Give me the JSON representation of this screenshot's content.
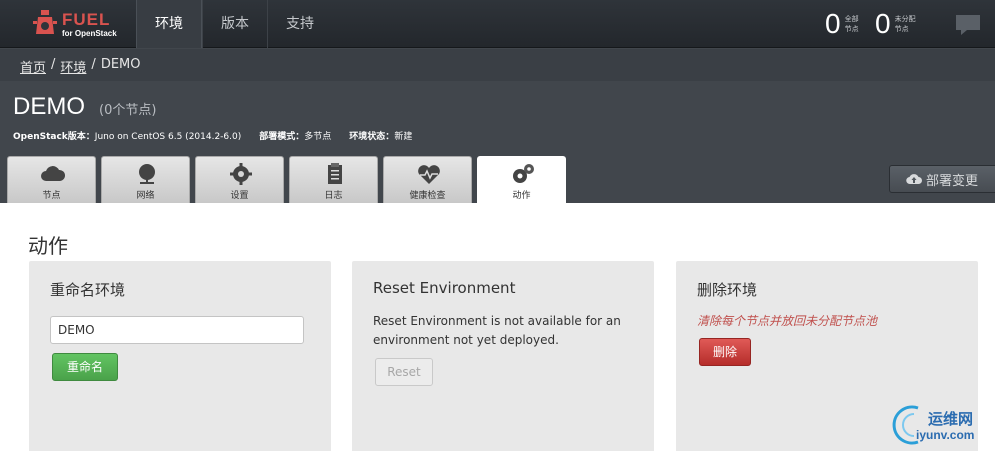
{
  "brand": {
    "name": "FUEL",
    "sub": "for OpenStack",
    "color": "#d9534f"
  },
  "nav": {
    "items": [
      "环境",
      "版本",
      "支持"
    ],
    "active_index": 0
  },
  "counters": [
    {
      "value": "0",
      "label_line1": "全部",
      "label_line2": "节点"
    },
    {
      "value": "0",
      "label_line1": "未分配",
      "label_line2": "节点"
    }
  ],
  "breadcrumb": {
    "home": "首页",
    "env": "环境",
    "current": "DEMO",
    "sep": "/"
  },
  "environment": {
    "name": "DEMO",
    "node_count": "(0个节点)",
    "openstack_label": "OpenStack版本：",
    "openstack_value": "Juno on CentOS 6.5 (2014.2-6.0)",
    "mode_label": "部署模式：",
    "mode_value": "多节点",
    "status_label": "环境状态：",
    "status_value": "新建"
  },
  "tabs": [
    {
      "label": "节点",
      "icon": "cloud-icon"
    },
    {
      "label": "网络",
      "icon": "network-icon"
    },
    {
      "label": "设置",
      "icon": "gear-icon"
    },
    {
      "label": "日志",
      "icon": "clipboard-icon"
    },
    {
      "label": "健康检查",
      "icon": "heart-pulse-icon"
    },
    {
      "label": "动作",
      "icon": "cogs-icon"
    }
  ],
  "active_tab_index": 5,
  "deploy_button": {
    "label": "部署变更",
    "icon": "cloud-upload-icon"
  },
  "actions": {
    "title": "动作",
    "rename": {
      "title": "重命名环境",
      "input_value": "DEMO",
      "button": "重命名"
    },
    "reset": {
      "title": "Reset Environment",
      "message": "Reset Environment is not available for an environment not yet deployed.",
      "button": "Reset"
    },
    "delete": {
      "title": "删除环境",
      "warning": "清除每个节点并放回未分配节点池",
      "button": "删除"
    }
  },
  "watermark": {
    "title": "运维网",
    "url": "iyunv.com"
  }
}
